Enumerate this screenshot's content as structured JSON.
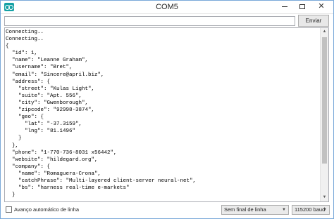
{
  "window": {
    "title": "COM5",
    "icon": "arduino-logo-icon",
    "minimize_icon": "minimize-icon",
    "maximize_icon": "maximize-icon",
    "close_icon": "close-icon",
    "close_glyph": "✕"
  },
  "send": {
    "input_value": "",
    "button_label": "Enviar"
  },
  "output": {
    "lines": [
      "Connecting..",
      "Connecting..",
      "{",
      "  \"id\": 1,",
      "  \"name\": \"Leanne Graham\",",
      "  \"username\": \"Bret\",",
      "  \"email\": \"Sincere@april.biz\",",
      "  \"address\": {",
      "    \"street\": \"Kulas Light\",",
      "    \"suite\": \"Apt. 556\",",
      "    \"city\": \"Gwenborough\",",
      "    \"zipcode\": \"92998-3874\",",
      "    \"geo\": {",
      "      \"lat\": \"-37.3159\",",
      "      \"lng\": \"81.1496\"",
      "    }",
      "  },",
      "  \"phone\": \"1-770-736-8031 x56442\",",
      "  \"website\": \"hildegard.org\",",
      "  \"company\": {",
      "    \"name\": \"Romaguera-Crona\",",
      "    \"catchPhrase\": \"Multi-layered client-server neural-net\",",
      "    \"bs\": \"harness real-time e-markets\"",
      "  }"
    ]
  },
  "footer": {
    "autoscroll_label": "Avanço automático de linha",
    "autoscroll_checked": false,
    "line_ending": "Sem final de linha",
    "baud_rate": "115200 baud"
  },
  "colors": {
    "border": "#7aa9d9",
    "button_bg": "#e8e8e8",
    "icon_teal": "#15a1a5"
  }
}
